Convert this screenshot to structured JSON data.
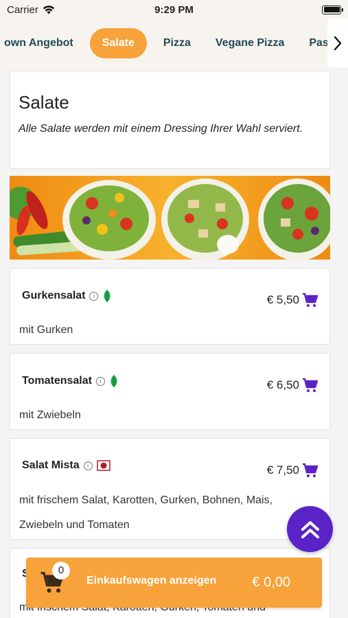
{
  "status_bar": {
    "carrier": "Carrier",
    "time": "9:29 PM"
  },
  "tabs": [
    {
      "label": "own Angebot",
      "active": false
    },
    {
      "label": "Salate",
      "active": true
    },
    {
      "label": "Pizza",
      "active": false
    },
    {
      "label": "Vegane Pizza",
      "active": false
    },
    {
      "label": "Pasta",
      "active": false
    }
  ],
  "section": {
    "title": "Salate",
    "description": "Alle Salate werden mit einem Dressing Ihrer Wahl serviert."
  },
  "items": [
    {
      "name": "Gurkensalat",
      "description": "mit Gurken",
      "price": "€ 5,50",
      "badge": "leaf-icon"
    },
    {
      "name": "Tomatensalat",
      "description": "mit Zwiebeln",
      "price": "€ 6,50",
      "badge": "leaf-icon"
    },
    {
      "name": "Salat Mista",
      "description": "mit frischem Salat, Karotten, Gurken, Bohnen, Mais, Zwiebeln und Tomaten",
      "price": "€ 7,50",
      "badge": "flag-icon"
    },
    {
      "name": "S",
      "description": "mit frischem Salat, Karotten, Gurken, Tomaten und"
    }
  ],
  "cart": {
    "count": "0",
    "label": "Einkaufswagen anzeigen",
    "total": "€ 0,00"
  },
  "colors": {
    "accent": "#f7a23a",
    "purple": "#5a23c8",
    "tab_text": "#234a55",
    "leaf": "#1fa84a"
  }
}
